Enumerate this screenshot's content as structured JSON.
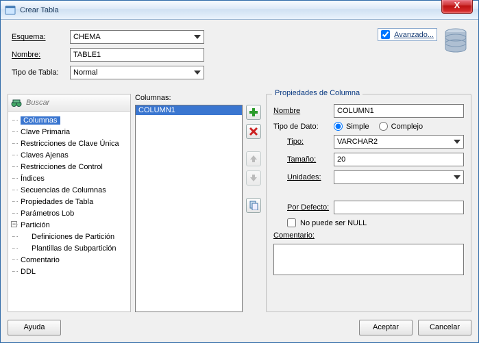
{
  "window": {
    "title": "Crear Tabla"
  },
  "form": {
    "schema_label": "Esquema:",
    "schema_value": "CHEMA",
    "name_label": "Nombre:",
    "name_value": "TABLE1",
    "type_label": "Tipo de Tabla:",
    "type_value": "Normal",
    "advanced_label": "Avanzado..."
  },
  "search": {
    "placeholder": "Buscar"
  },
  "tree": {
    "items": [
      "Columnas",
      "Clave Primaria",
      "Restricciones de Clave Única",
      "Claves Ajenas",
      "Restricciones de Control",
      "Índices",
      "Secuencias de Columnas",
      "Propiedades de Tabla",
      "Parámetros Lob"
    ],
    "partition_label": "Partición",
    "partition_children": [
      "Definiciones de Partición",
      "Plantillas de Subpartición"
    ],
    "tail": [
      "Comentario",
      "DDL"
    ],
    "selected_index": 0
  },
  "columns": {
    "label": "Columnas:",
    "items": [
      "COLUMN1"
    ]
  },
  "icon_buttons": {
    "add": "add-icon",
    "remove": "remove-icon",
    "up": "arrow-up-icon",
    "down": "arrow-down-icon",
    "copy": "copy-icon"
  },
  "props": {
    "group_title": "Propiedades de Columna",
    "name_label": "Nombre",
    "name_value": "COLUMN1",
    "datatype_label": "Tipo de Dato:",
    "simple_label": "Simple",
    "complex_label": "Complejo",
    "datatype_mode": "simple",
    "type_label": "Tipo:",
    "type_value": "VARCHAR2",
    "size_label": "Tamaño:",
    "size_value": "20",
    "units_label": "Unidades:",
    "units_value": "",
    "default_label": "Por Defecto:",
    "default_value": "",
    "notnull_label": "No puede ser NULL",
    "notnull_checked": false,
    "comment_label": "Comentario:",
    "comment_value": ""
  },
  "buttons": {
    "help": "Ayuda",
    "ok": "Aceptar",
    "cancel": "Cancelar"
  }
}
